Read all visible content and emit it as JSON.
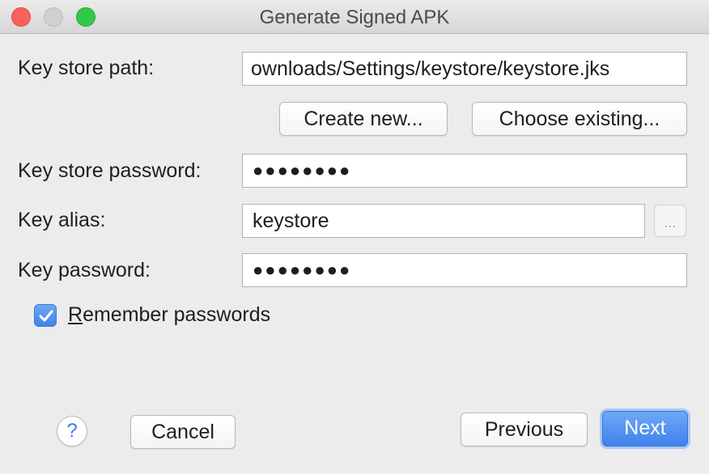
{
  "window": {
    "title": "Generate Signed APK"
  },
  "form": {
    "keystore_path": {
      "label": "Key store path:",
      "value": "ownloads/Settings/keystore/keystore.jks"
    },
    "create_new_label": "Create new...",
    "choose_existing_label": "Choose existing...",
    "keystore_password": {
      "label": "Key store password:",
      "value": "●●●●●●●●"
    },
    "key_alias": {
      "label": "Key alias:",
      "value": "keystore",
      "browse_label": "..."
    },
    "key_password": {
      "label": "Key password:",
      "value": "●●●●●●●●"
    },
    "remember": {
      "label_first": "R",
      "label_rest": "emember passwords",
      "checked": true
    }
  },
  "footer": {
    "help_label": "?",
    "cancel_label": "Cancel",
    "previous_label": "Previous",
    "next_label": "Next"
  },
  "colors": {
    "accent": "#3f82ea",
    "close": "#fc605c",
    "maximize": "#34c84a",
    "background": "#ececec"
  }
}
